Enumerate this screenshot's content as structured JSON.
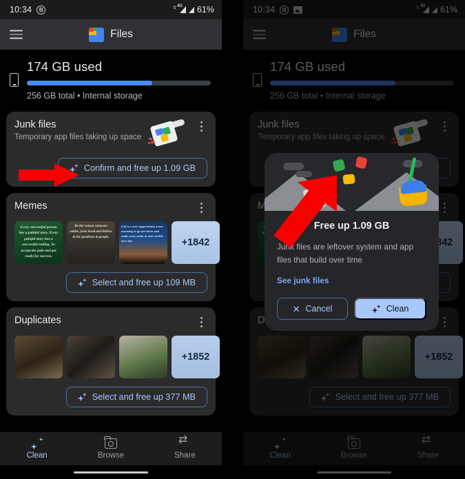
{
  "statusbar": {
    "time": "10:34",
    "icons_left": [
      "circled-b-icon",
      "screenshot-image-icon"
    ],
    "network": "4G",
    "battery": "61%"
  },
  "appbar": {
    "menu_icon": "hamburger-menu-icon",
    "app_name": "Files",
    "logo_icon": "files-app-logo"
  },
  "storage": {
    "used_title": "174 GB used",
    "subtitle": "256 GB total • Internal storage",
    "percent_used": 68,
    "bar_fill_color": "#4b8bf5",
    "bar_track_color": "#3c3f43",
    "device_icon": "phone-icon"
  },
  "cards": [
    {
      "id": "junk-files",
      "title": "Junk files",
      "subtitle": "Temporary app files taking up space",
      "illustration": "dustpan-with-files-icon",
      "cta": "Confirm and free up 1.09 GB",
      "menu_icon": "overflow-menu-icon"
    },
    {
      "id": "memes",
      "title": "Memes",
      "subtitle": "",
      "cta": "Select and free up 109 MB",
      "menu_icon": "overflow-menu-icon",
      "thumbnails": [
        {
          "kind": "quote-green",
          "text": "Every successful person has a painful story. Every painful story has a successful ending. So accept the pain and get ready for success."
        },
        {
          "kind": "quote-monk",
          "text": "Be the reason someone smiles, feels loved and believe in the goodness in people."
        },
        {
          "kind": "quote-sunset",
          "text": "Life is a new opportunity every morning to go out there and make your smile at start of this new day"
        },
        {
          "kind": "more-count",
          "text": "+1842"
        }
      ]
    },
    {
      "id": "duplicates",
      "title": "Duplicates",
      "subtitle": "",
      "cta": "Select and free up 377 MB",
      "menu_icon": "overflow-menu-icon",
      "thumbnails": [
        {
          "kind": "photo-cave",
          "text": ""
        },
        {
          "kind": "photo-person-panel",
          "text": ""
        },
        {
          "kind": "photo-escalator",
          "text": ""
        },
        {
          "kind": "more-count",
          "text": "+1852"
        }
      ]
    }
  ],
  "bottomnav": {
    "items": [
      {
        "label": "Clean",
        "icon": "sparkle-icon",
        "active": true
      },
      {
        "label": "Browse",
        "icon": "folder-search-icon",
        "active": false
      },
      {
        "label": "Share",
        "icon": "share-arrows-icon",
        "active": false
      }
    ],
    "active_color": "#a8c7fa",
    "inactive_color": "#9e9e9e"
  },
  "dialog": {
    "title": "Free up 1.09 GB",
    "body": "Junk files are leftover system and app files that build over time",
    "link": "See junk files",
    "cancel_label": "Cancel",
    "cancel_icon": "close-x-icon",
    "clean_label": "Clean",
    "clean_icon": "sparkle-icon",
    "illustration": "broom-sweeping-files-illustration",
    "accent_color": "#a8c7fa"
  },
  "annotations": {
    "arrow_color": "#f60000",
    "left_arrow_target": "Confirm and free up 1.09 GB",
    "right_arrow_target": "Clean"
  }
}
